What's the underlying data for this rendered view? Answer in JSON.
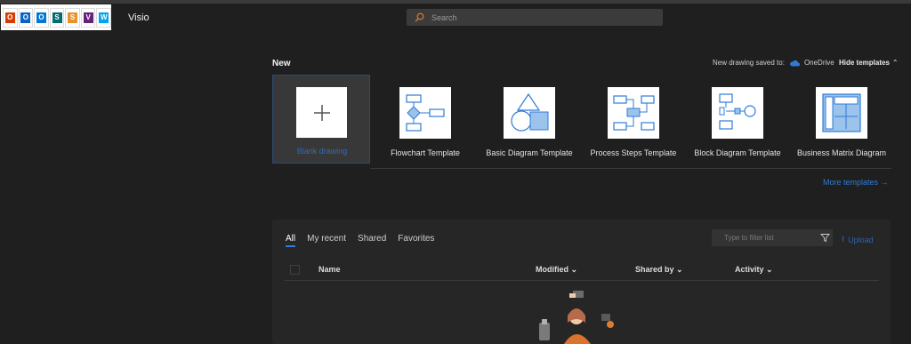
{
  "app": {
    "name": "Visio"
  },
  "launcher_apps": [
    {
      "icon": "office-icon",
      "letter": "O",
      "color": "#d83b01"
    },
    {
      "icon": "outlook-icon",
      "letter": "O",
      "color": "#0a64c8"
    },
    {
      "icon": "outlook-alt-icon",
      "letter": "O",
      "color": "#0078d4"
    },
    {
      "icon": "sharepoint-icon",
      "letter": "S",
      "color": "#036c70"
    },
    {
      "icon": "sway-icon",
      "letter": "S",
      "color": "#e8912d"
    },
    {
      "icon": "visual-studio-icon",
      "letter": "V",
      "color": "#68217a"
    },
    {
      "icon": "windows-icon",
      "letter": "W",
      "color": "#00a4ef"
    }
  ],
  "search": {
    "placeholder": "Search"
  },
  "new_section": {
    "title": "New",
    "saved_to_label": "New drawing saved to:",
    "saved_to_location": "OneDrive",
    "hide_templates_label": "Hide templates",
    "more_templates_label": "More templates"
  },
  "templates": [
    {
      "label": "Blank drawing",
      "icon": "plus-icon"
    },
    {
      "label": "Flowchart Template",
      "icon": "flowchart-icon"
    },
    {
      "label": "Basic Diagram Template",
      "icon": "basic-diagram-icon"
    },
    {
      "label": "Process Steps Template",
      "icon": "process-steps-icon"
    },
    {
      "label": "Block Diagram Template",
      "icon": "block-diagram-icon"
    },
    {
      "label": "Business Matrix Diagram",
      "icon": "business-matrix-icon"
    }
  ],
  "files": {
    "tabs": [
      "All",
      "My recent",
      "Shared",
      "Favorites"
    ],
    "active_tab": "All",
    "filter_placeholder": "Type to filter list",
    "upload_label": "Upload",
    "columns": {
      "name": "Name",
      "modified": "Modified",
      "shared_by": "Shared by",
      "activity": "Activity"
    }
  },
  "colors": {
    "accent": "#2f7bd6",
    "background": "#1f1f1f",
    "panel": "#262626"
  }
}
